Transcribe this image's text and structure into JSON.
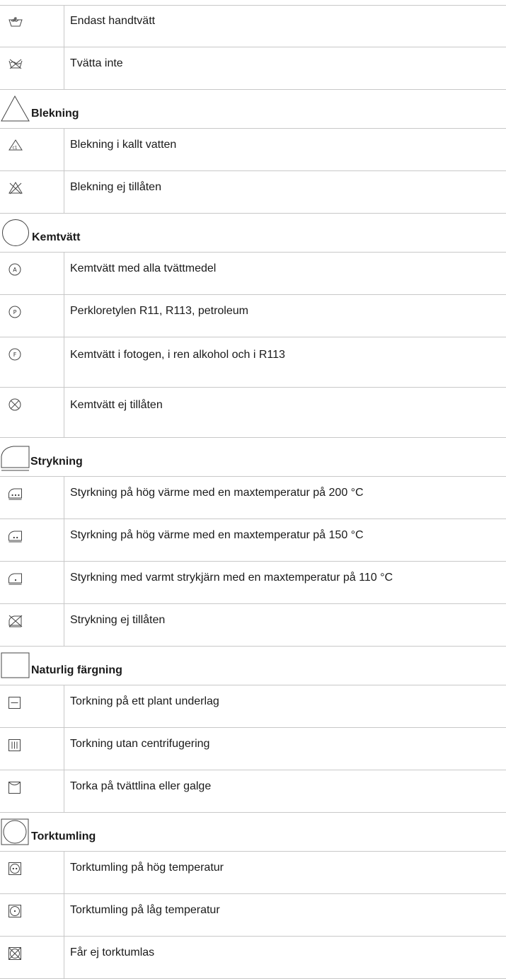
{
  "sections": [
    {
      "kind": "row",
      "icon": "handwash-icon",
      "label": "Endast handtvätt"
    },
    {
      "kind": "row",
      "icon": "no-wash-icon",
      "label": "Tvätta inte"
    },
    {
      "kind": "header",
      "icon": "triangle-icon",
      "title": "Blekning"
    },
    {
      "kind": "row",
      "icon": "bleach-cold-icon",
      "label": "Blekning i kallt vatten"
    },
    {
      "kind": "row",
      "icon": "no-bleach-icon",
      "label": "Blekning ej tillåten"
    },
    {
      "kind": "header",
      "icon": "circle-icon",
      "title": "Kemtvätt"
    },
    {
      "kind": "row",
      "icon": "dryclean-a-icon",
      "label": "Kemtvätt med alla tvättmedel",
      "letter": "A"
    },
    {
      "kind": "row",
      "icon": "dryclean-p-icon",
      "label": "Perkloretylen R11, R113, petroleum",
      "letter": "P"
    },
    {
      "kind": "row",
      "icon": "dryclean-f-icon",
      "label": "Kemtvätt i fotogen, i ren alkohol och i R113",
      "letter": "F",
      "tall": true
    },
    {
      "kind": "row",
      "icon": "no-dryclean-icon",
      "label": "Kemtvätt ej tillåten",
      "tall": true
    },
    {
      "kind": "header",
      "icon": "iron-icon",
      "title": "Strykning"
    },
    {
      "kind": "row",
      "icon": "iron-3dots-icon",
      "label": "Styrkning på hög värme med en maxtemperatur på 200 °C"
    },
    {
      "kind": "row",
      "icon": "iron-2dots-icon",
      "label": "Styrkning på hög värme med en maxtemperatur på 150 °C"
    },
    {
      "kind": "row",
      "icon": "iron-1dot-icon",
      "label": "Styrkning med varmt strykjärn med en maxtemperatur på 110 °C"
    },
    {
      "kind": "row",
      "icon": "no-iron-icon",
      "label": "Strykning ej tillåten"
    },
    {
      "kind": "header",
      "icon": "square-icon",
      "title": "Naturlig färgning"
    },
    {
      "kind": "row",
      "icon": "dry-flat-icon",
      "label": "Torkning på ett plant underlag"
    },
    {
      "kind": "row",
      "icon": "drip-dry-icon",
      "label": "Torkning utan centrifugering"
    },
    {
      "kind": "row",
      "icon": "line-dry-icon",
      "label": "Torka på tvättlina eller galge"
    },
    {
      "kind": "header",
      "icon": "tumble-dry-icon",
      "title": "Torktumling"
    },
    {
      "kind": "row",
      "icon": "tumble-high-icon",
      "label": "Torktumling på hög temperatur"
    },
    {
      "kind": "row",
      "icon": "tumble-low-icon",
      "label": "Torktumling på låg temperatur"
    },
    {
      "kind": "row",
      "icon": "no-tumble-icon",
      "label": "Får ej torktumlas"
    }
  ]
}
